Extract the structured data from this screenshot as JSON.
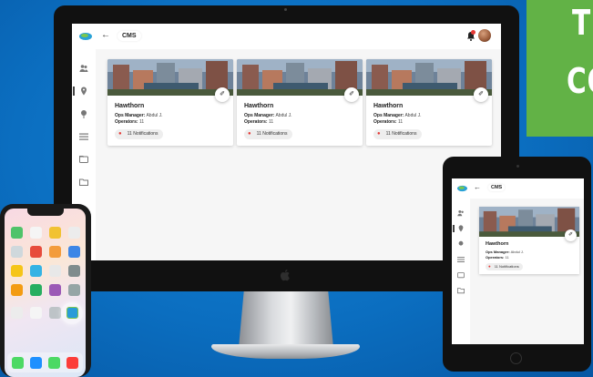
{
  "app": {
    "title": "CMS",
    "back_icon": "arrow-left-icon",
    "logo_icon": "brand-logo-icon"
  },
  "header": {
    "notifications_icon": "bell-icon",
    "avatar": "user-avatar"
  },
  "sidebar": {
    "items": [
      {
        "icon": "users-icon"
      },
      {
        "icon": "location-icon",
        "active": true
      },
      {
        "icon": "pin-icon"
      },
      {
        "icon": "list-icon"
      },
      {
        "icon": "folder-icon"
      },
      {
        "icon": "folder-open-icon"
      }
    ]
  },
  "cards": [
    {
      "title": "Hawthorn",
      "manager_label": "Ops Manager:",
      "manager_value": "Abdul J.",
      "operators_label": "Operators:",
      "operators_value": "11",
      "notifications": "11 Notifications"
    },
    {
      "title": "Hawthorn",
      "manager_label": "Ops Manager:",
      "manager_value": "Abdul J.",
      "operators_label": "Operators:",
      "operators_value": "11",
      "notifications": "11 Notifications"
    },
    {
      "title": "Hawthorn",
      "manager_label": "Ops Manager:",
      "manager_value": "Abdul J.",
      "operators_label": "Operators:",
      "operators_value": "11",
      "notifications": "11 Notifications"
    }
  ],
  "tablet_card": {
    "title": "Hawthorn",
    "manager_label": "Ops Manager:",
    "manager_value": "Abdul J.",
    "operators_label": "Operators:",
    "operators_value": "11",
    "notifications": "11 Notifications"
  },
  "promo": {
    "line1": "TI",
    "line2": "CO"
  },
  "colors": {
    "background": "#0b6ec0",
    "promo_green": "#62b246",
    "notification_red": "#e53935"
  }
}
